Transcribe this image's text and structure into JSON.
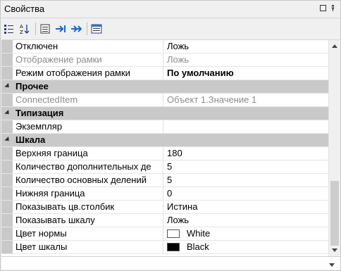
{
  "panel": {
    "title": "Свойства"
  },
  "toolbar": {
    "buttons": [
      {
        "name": "categorized-view-button",
        "icon": "categorized-icon"
      },
      {
        "name": "alphabetical-sort-button",
        "icon": "sort-az-icon"
      },
      {
        "name": "properties-button",
        "icon": "properties-icon"
      },
      {
        "name": "events-button",
        "icon": "arrow-right-icon"
      },
      {
        "name": "methods-button",
        "icon": "double-arrow-icon"
      },
      {
        "name": "property-pages-button",
        "icon": "property-pages-icon"
      }
    ]
  },
  "grid": {
    "rows": [
      {
        "type": "prop",
        "name": "Отключен",
        "value": "Ложь",
        "state": "normal"
      },
      {
        "type": "prop",
        "name": "Отображение рамки",
        "value": "Ложь",
        "state": "disabled"
      },
      {
        "type": "prop",
        "name": "Режим отображения рамки",
        "value": "По умолчанию",
        "state": "bold-value"
      },
      {
        "type": "category",
        "name": "Прочее"
      },
      {
        "type": "prop",
        "name": "ConnectedItem",
        "value": "Объект 1.Значение 1",
        "state": "disabled"
      },
      {
        "type": "category",
        "name": "Типизация"
      },
      {
        "type": "prop",
        "name": "Экземпляр",
        "value": "",
        "state": "normal"
      },
      {
        "type": "category",
        "name": "Шкала"
      },
      {
        "type": "prop",
        "name": "Верхняя граница",
        "value": "180",
        "state": "normal"
      },
      {
        "type": "prop",
        "name": "Количество дополнительных де",
        "value": "5",
        "state": "normal"
      },
      {
        "type": "prop",
        "name": "Количество основных делений",
        "value": "5",
        "state": "normal"
      },
      {
        "type": "prop",
        "name": "Нижняя граница",
        "value": "0",
        "state": "normal"
      },
      {
        "type": "prop",
        "name": "Показывать цв.столбик",
        "value": "Истина",
        "state": "normal"
      },
      {
        "type": "prop",
        "name": "Показывать шкалу",
        "value": "Ложь",
        "state": "normal"
      },
      {
        "type": "prop",
        "name": "Цвет нормы",
        "value": "White",
        "state": "normal",
        "swatch": "#ffffff"
      },
      {
        "type": "prop",
        "name": "Цвет шкалы",
        "value": "Black",
        "state": "normal",
        "swatch": "#000000"
      }
    ]
  }
}
